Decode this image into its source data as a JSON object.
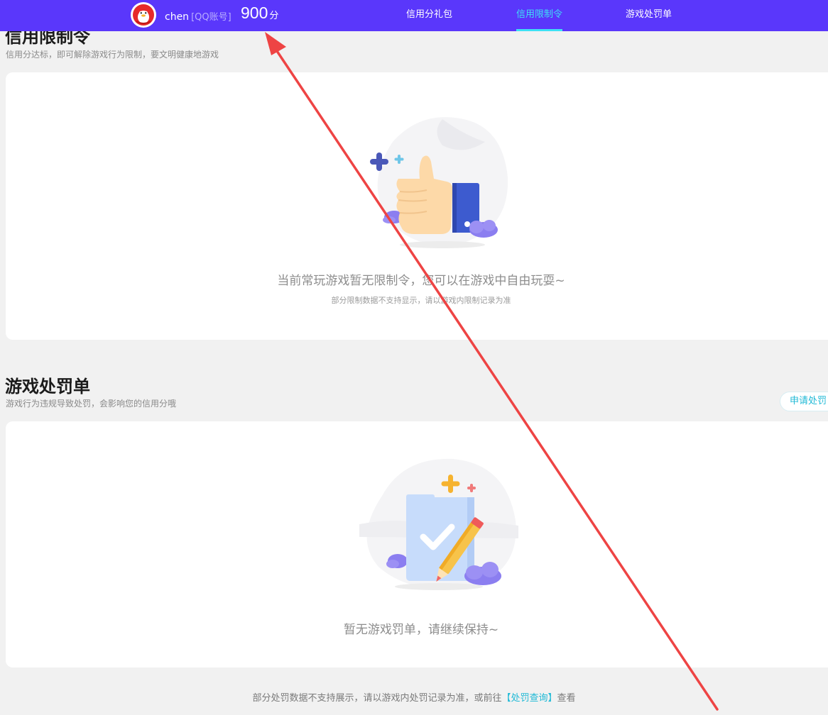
{
  "header": {
    "username": "chen",
    "account_type": "[QQ账号]",
    "score": "900",
    "score_unit": "分",
    "nav": [
      {
        "label": "信用分礼包"
      },
      {
        "label": "信用限制令",
        "active": true
      },
      {
        "label": "游戏处罚单"
      }
    ],
    "colors": {
      "bar": "#5a37fb",
      "active": "#3ee0f5"
    }
  },
  "restriction": {
    "title": "信用限制令",
    "desc": "信用分达标，即可解除游戏行为限制，要文明健康地游戏",
    "empty_text": "当前常玩游戏暂无限制令，您可以在游戏中自由玩耍~",
    "note": "部分限制数据不支持显示，请以游戏内限制记录为准",
    "illustration": "thumbs-up-illustration"
  },
  "penalty": {
    "title": "游戏处罚单",
    "desc": "游戏行为违规导致处罚，会影响您的信用分哦",
    "appeal_button": "申请处罚",
    "empty_text": "暂无游戏罚单，请继续保持~",
    "illustration": "checklist-pencil-illustration"
  },
  "footer": {
    "note_prefix": "部分处罚数据不支持展示，请以游戏内处罚记录为准，或前往",
    "link": "【处罚查询】",
    "note_suffix": "查看"
  },
  "annotation": {
    "type": "red-arrow",
    "color": "#ee4444"
  }
}
